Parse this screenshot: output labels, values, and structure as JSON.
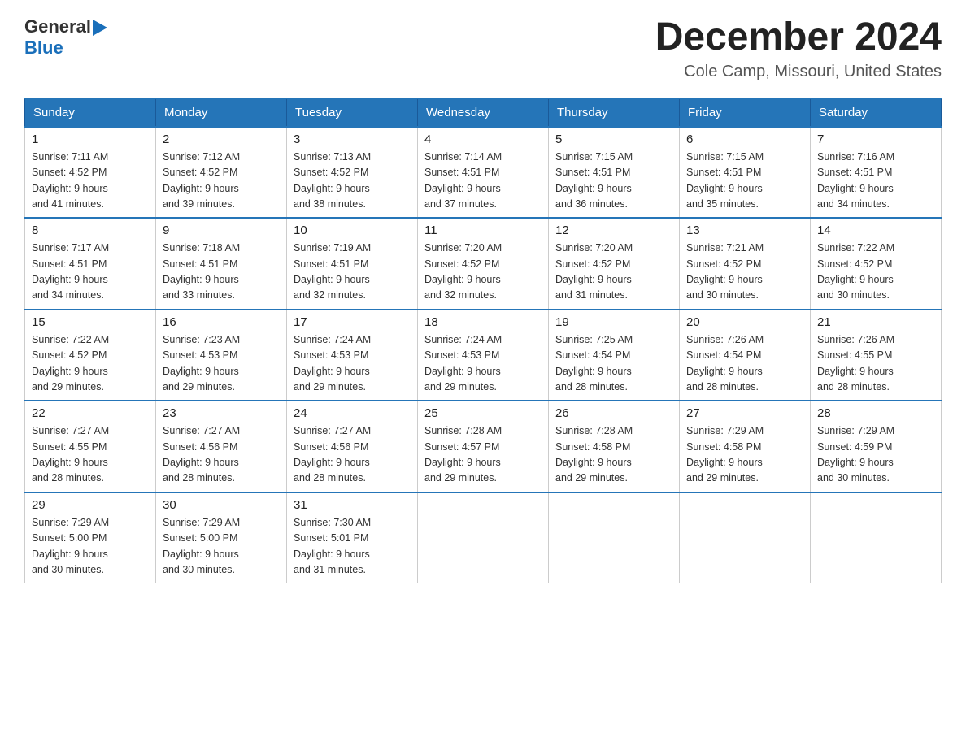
{
  "header": {
    "logo_general": "General",
    "logo_blue": "Blue",
    "main_title": "December 2024",
    "subtitle": "Cole Camp, Missouri, United States"
  },
  "weekdays": [
    "Sunday",
    "Monday",
    "Tuesday",
    "Wednesday",
    "Thursday",
    "Friday",
    "Saturday"
  ],
  "weeks": [
    [
      {
        "day": "1",
        "sunrise": "7:11 AM",
        "sunset": "4:52 PM",
        "daylight": "9 hours and 41 minutes."
      },
      {
        "day": "2",
        "sunrise": "7:12 AM",
        "sunset": "4:52 PM",
        "daylight": "9 hours and 39 minutes."
      },
      {
        "day": "3",
        "sunrise": "7:13 AM",
        "sunset": "4:52 PM",
        "daylight": "9 hours and 38 minutes."
      },
      {
        "day": "4",
        "sunrise": "7:14 AM",
        "sunset": "4:51 PM",
        "daylight": "9 hours and 37 minutes."
      },
      {
        "day": "5",
        "sunrise": "7:15 AM",
        "sunset": "4:51 PM",
        "daylight": "9 hours and 36 minutes."
      },
      {
        "day": "6",
        "sunrise": "7:15 AM",
        "sunset": "4:51 PM",
        "daylight": "9 hours and 35 minutes."
      },
      {
        "day": "7",
        "sunrise": "7:16 AM",
        "sunset": "4:51 PM",
        "daylight": "9 hours and 34 minutes."
      }
    ],
    [
      {
        "day": "8",
        "sunrise": "7:17 AM",
        "sunset": "4:51 PM",
        "daylight": "9 hours and 34 minutes."
      },
      {
        "day": "9",
        "sunrise": "7:18 AM",
        "sunset": "4:51 PM",
        "daylight": "9 hours and 33 minutes."
      },
      {
        "day": "10",
        "sunrise": "7:19 AM",
        "sunset": "4:51 PM",
        "daylight": "9 hours and 32 minutes."
      },
      {
        "day": "11",
        "sunrise": "7:20 AM",
        "sunset": "4:52 PM",
        "daylight": "9 hours and 32 minutes."
      },
      {
        "day": "12",
        "sunrise": "7:20 AM",
        "sunset": "4:52 PM",
        "daylight": "9 hours and 31 minutes."
      },
      {
        "day": "13",
        "sunrise": "7:21 AM",
        "sunset": "4:52 PM",
        "daylight": "9 hours and 30 minutes."
      },
      {
        "day": "14",
        "sunrise": "7:22 AM",
        "sunset": "4:52 PM",
        "daylight": "9 hours and 30 minutes."
      }
    ],
    [
      {
        "day": "15",
        "sunrise": "7:22 AM",
        "sunset": "4:52 PM",
        "daylight": "9 hours and 29 minutes."
      },
      {
        "day": "16",
        "sunrise": "7:23 AM",
        "sunset": "4:53 PM",
        "daylight": "9 hours and 29 minutes."
      },
      {
        "day": "17",
        "sunrise": "7:24 AM",
        "sunset": "4:53 PM",
        "daylight": "9 hours and 29 minutes."
      },
      {
        "day": "18",
        "sunrise": "7:24 AM",
        "sunset": "4:53 PM",
        "daylight": "9 hours and 29 minutes."
      },
      {
        "day": "19",
        "sunrise": "7:25 AM",
        "sunset": "4:54 PM",
        "daylight": "9 hours and 28 minutes."
      },
      {
        "day": "20",
        "sunrise": "7:26 AM",
        "sunset": "4:54 PM",
        "daylight": "9 hours and 28 minutes."
      },
      {
        "day": "21",
        "sunrise": "7:26 AM",
        "sunset": "4:55 PM",
        "daylight": "9 hours and 28 minutes."
      }
    ],
    [
      {
        "day": "22",
        "sunrise": "7:27 AM",
        "sunset": "4:55 PM",
        "daylight": "9 hours and 28 minutes."
      },
      {
        "day": "23",
        "sunrise": "7:27 AM",
        "sunset": "4:56 PM",
        "daylight": "9 hours and 28 minutes."
      },
      {
        "day": "24",
        "sunrise": "7:27 AM",
        "sunset": "4:56 PM",
        "daylight": "9 hours and 28 minutes."
      },
      {
        "day": "25",
        "sunrise": "7:28 AM",
        "sunset": "4:57 PM",
        "daylight": "9 hours and 29 minutes."
      },
      {
        "day": "26",
        "sunrise": "7:28 AM",
        "sunset": "4:58 PM",
        "daylight": "9 hours and 29 minutes."
      },
      {
        "day": "27",
        "sunrise": "7:29 AM",
        "sunset": "4:58 PM",
        "daylight": "9 hours and 29 minutes."
      },
      {
        "day": "28",
        "sunrise": "7:29 AM",
        "sunset": "4:59 PM",
        "daylight": "9 hours and 30 minutes."
      }
    ],
    [
      {
        "day": "29",
        "sunrise": "7:29 AM",
        "sunset": "5:00 PM",
        "daylight": "9 hours and 30 minutes."
      },
      {
        "day": "30",
        "sunrise": "7:29 AM",
        "sunset": "5:00 PM",
        "daylight": "9 hours and 30 minutes."
      },
      {
        "day": "31",
        "sunrise": "7:30 AM",
        "sunset": "5:01 PM",
        "daylight": "9 hours and 31 minutes."
      },
      null,
      null,
      null,
      null
    ]
  ],
  "labels": {
    "sunrise": "Sunrise:",
    "sunset": "Sunset:",
    "daylight": "Daylight:"
  }
}
